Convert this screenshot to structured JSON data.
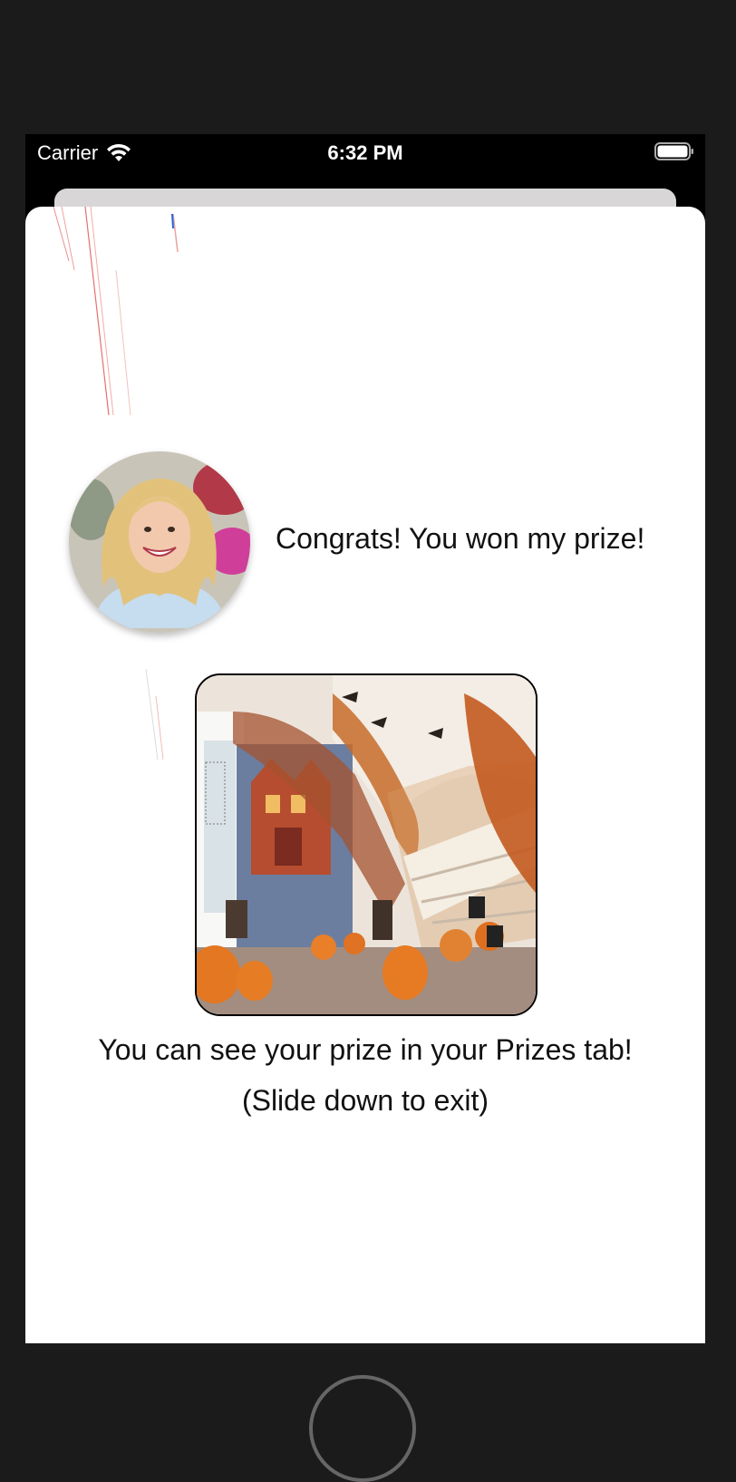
{
  "status_bar": {
    "carrier": "Carrier",
    "time": "6:32 PM",
    "wifi_icon": "wifi-icon",
    "battery_icon": "battery-icon"
  },
  "sheet": {
    "congrats_message": "Congrats! You won my prize!",
    "prize_caption": "You can see your prize in your Prizes tab!",
    "exit_hint": "(Slide down to exit)",
    "avatar_icon": "host-avatar",
    "prize_image_icon": "halloween-prize-image"
  },
  "colors": {
    "background": "#1b1b1b",
    "sheet": "#ffffff",
    "text": "#111111"
  }
}
